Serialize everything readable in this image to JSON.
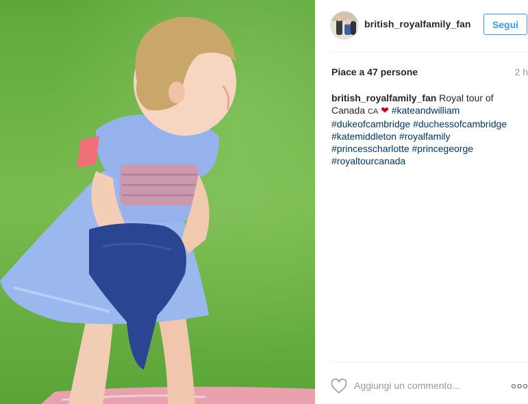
{
  "post": {
    "author": "british_royalfamily_fan",
    "follow_label": "Segui"
  },
  "stats": {
    "likes_text": "Piace a 47 persone",
    "time_ago": "2 h"
  },
  "caption": {
    "username": "british_royalfamily_fan",
    "text": "Royal tour of Canada",
    "flag_text": "CA",
    "heart_icon": "heart-emoji",
    "hashtags": [
      "#kateandwilliam",
      "#dukeofcambridge",
      "#duchessofcambridge",
      "#katemiddleton",
      "#royalfamily",
      "#princesscharlotte",
      "#princegeorge",
      "#royaltourcanada"
    ]
  },
  "comment": {
    "placeholder": "Aggiungi un commento..."
  },
  "icons": {
    "like": "heart-outline-icon",
    "more": "more-options-icon"
  },
  "colors": {
    "accent": "#3897f0",
    "hashtag": "#003569",
    "heart": "#c50a0a",
    "grass": "#6fb24a"
  }
}
